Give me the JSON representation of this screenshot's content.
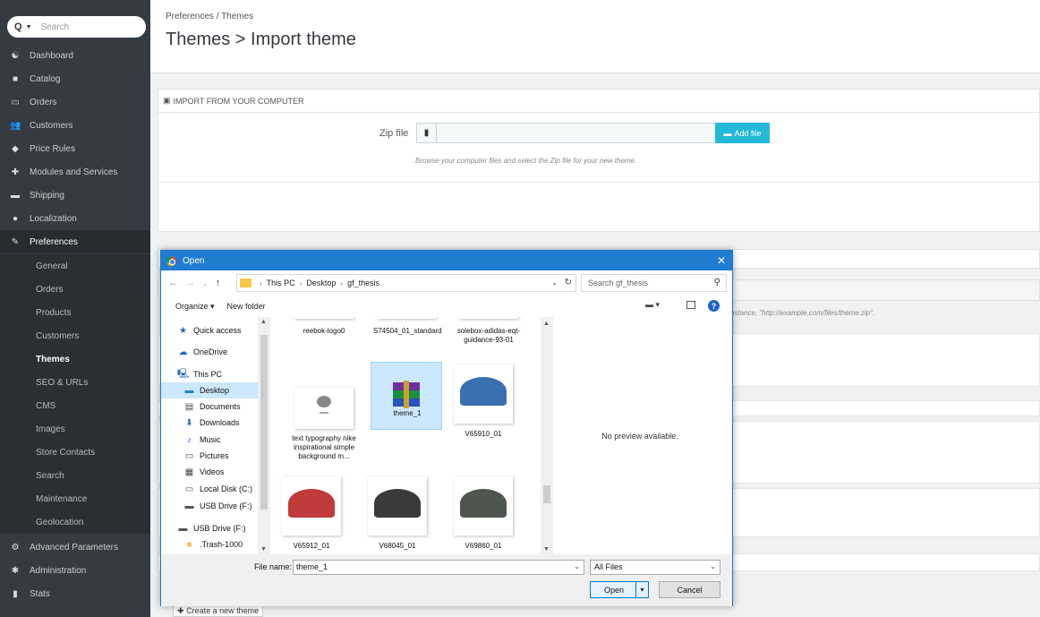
{
  "sidebar": {
    "search_placeholder": "Search",
    "items": [
      {
        "label": "Dashboard",
        "icon": "dashboard-icon",
        "glyph": "☯"
      },
      {
        "label": "Catalog",
        "icon": "book-icon",
        "glyph": "■"
      },
      {
        "label": "Orders",
        "icon": "credit-card-icon",
        "glyph": "▭"
      },
      {
        "label": "Customers",
        "icon": "users-icon",
        "glyph": "👥"
      },
      {
        "label": "Price Rules",
        "icon": "tag-icon",
        "glyph": "◆"
      },
      {
        "label": "Modules and Services",
        "icon": "puzzle-icon",
        "glyph": "✚"
      },
      {
        "label": "Shipping",
        "icon": "truck-icon",
        "glyph": "▬"
      },
      {
        "label": "Localization",
        "icon": "globe-icon",
        "glyph": "●"
      },
      {
        "label": "Preferences",
        "icon": "wrench-icon",
        "glyph": "✎"
      }
    ],
    "subitems": [
      "General",
      "Orders",
      "Products",
      "Customers",
      "Themes",
      "SEO & URLs",
      "CMS",
      "Images",
      "Store Contacts",
      "Search",
      "Maintenance",
      "Geolocation"
    ],
    "bottom_items": [
      {
        "label": "Advanced Parameters",
        "icon": "cogs-icon",
        "glyph": "⚙"
      },
      {
        "label": "Administration",
        "icon": "cog-icon",
        "glyph": "✱"
      },
      {
        "label": "Stats",
        "icon": "bar-chart-icon",
        "glyph": "▮"
      }
    ]
  },
  "header": {
    "breadcrumb": "Preferences  /  Themes",
    "title": "Themes > Import theme"
  },
  "import_panel": {
    "heading": "IMPORT FROM YOUR COMPUTER",
    "zip_label": "Zip file",
    "add_file_label": "Add file",
    "help_text": "Browse your computer files and select the Zip file for your new theme."
  },
  "background": {
    "url_help_fragment": "nstance, \"http://example.com/files/theme.zip\".",
    "create_theme_label": "Create a new theme"
  },
  "dialog": {
    "title": "Open",
    "path": [
      "This PC",
      "Desktop",
      "gf_thesis"
    ],
    "search_placeholder": "Search gf_thesis",
    "organize_label": "Organize ▾",
    "new_folder_label": "New folder",
    "tree": [
      {
        "label": "Quick access",
        "icon": "star-icon",
        "glyph": "★",
        "color": "#1a66c4"
      },
      {
        "label": "OneDrive",
        "icon": "cloud-icon",
        "glyph": "☁",
        "color": "#1a66c4"
      },
      {
        "label": "This PC",
        "icon": "computer-icon",
        "glyph": "🖳",
        "color": "#1a66c4"
      },
      {
        "label": "Desktop",
        "icon": "desktop-icon",
        "glyph": "▬",
        "color": "#1a86d4"
      },
      {
        "label": "Documents",
        "icon": "documents-icon",
        "glyph": "▤",
        "color": "#444"
      },
      {
        "label": "Downloads",
        "icon": "download-icon",
        "glyph": "⬇",
        "color": "#1a66c4"
      },
      {
        "label": "Music",
        "icon": "music-icon",
        "glyph": "♪",
        "color": "#1a66c4"
      },
      {
        "label": "Pictures",
        "icon": "pictures-icon",
        "glyph": "▭",
        "color": "#444"
      },
      {
        "label": "Videos",
        "icon": "videos-icon",
        "glyph": "▦",
        "color": "#444"
      },
      {
        "label": "Local Disk (C:)",
        "icon": "disk-icon",
        "glyph": "▭",
        "color": "#555"
      },
      {
        "label": "USB Drive (F:)",
        "icon": "usb-drive-icon",
        "glyph": "▬",
        "color": "#555"
      },
      {
        "label": "USB Drive (F:)",
        "icon": "usb-drive-icon",
        "glyph": "▬",
        "color": "#555"
      },
      {
        "label": ".Trash-1000",
        "icon": "folder-icon",
        "glyph": "■",
        "color": "#f6c84a"
      }
    ],
    "files": [
      {
        "name": "reebok-logo0",
        "thumb": "partial"
      },
      {
        "name": "S74504_01_standard",
        "thumb": "partial"
      },
      {
        "name": "solebox-adidas-eqt-guidance-93-01",
        "thumb": "partial"
      },
      {
        "name": "text typography nike inspirational simple background m...",
        "thumb": "brain"
      },
      {
        "name": "theme_1",
        "thumb": "winrar"
      },
      {
        "name": "V65910_01",
        "thumb": "shoe-blue"
      },
      {
        "name": "V65912_01",
        "thumb": "shoe-red"
      },
      {
        "name": "V68045_01",
        "thumb": "shoe-black"
      },
      {
        "name": "V69860_01",
        "thumb": "shoe-grey"
      }
    ],
    "preview_text": "No preview available.",
    "file_name_label": "File name:",
    "file_name_value": "theme_1",
    "filter_value": "All Files",
    "open_label": "Open",
    "cancel_label": "Cancel"
  },
  "colors": {
    "sidebar_bg": "#363a41",
    "accent": "#25b9d7",
    "dialog_title": "#1f7cd1"
  }
}
